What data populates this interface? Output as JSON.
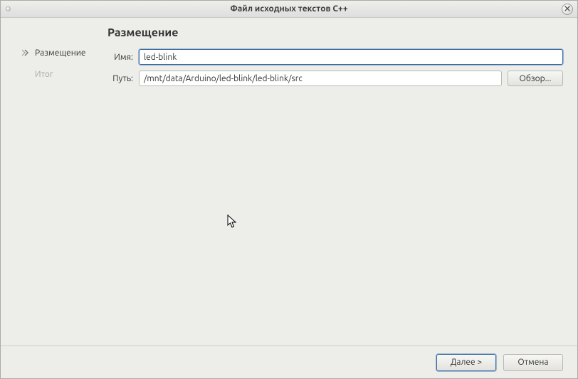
{
  "window": {
    "title": "Файл исходных текстов C++"
  },
  "sidebar": {
    "items": [
      {
        "label": "Размещение",
        "active": true
      },
      {
        "label": "Итог",
        "active": false
      }
    ]
  },
  "main": {
    "heading": "Размещение",
    "fields": {
      "name": {
        "label": "Имя:",
        "value": "led-blink"
      },
      "path": {
        "label": "Путь:",
        "value": "/mnt/data/Arduino/led-blink/led-blink/src"
      }
    },
    "browse_label": "Обзор..."
  },
  "footer": {
    "next": {
      "prefix": "Д",
      "rest": "алее >"
    },
    "cancel": {
      "label": "Отмена"
    }
  }
}
